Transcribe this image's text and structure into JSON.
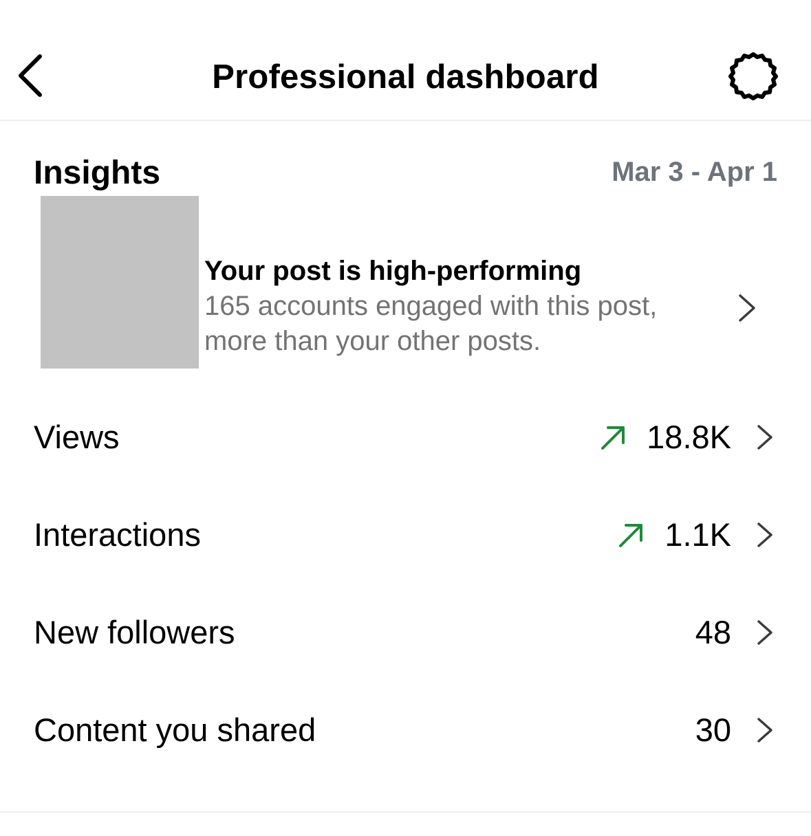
{
  "header": {
    "title": "Professional dashboard",
    "back_icon": "chevron-left-icon",
    "settings_icon": "gear-icon"
  },
  "insights": {
    "title": "Insights",
    "date_range": "Mar 3 - Apr 1"
  },
  "highlight": {
    "title": "Your post is high-performing",
    "body": "165 accounts engaged with this post, more than your other posts."
  },
  "metrics": [
    {
      "label": "Views",
      "value": "18.8K",
      "trend": "up"
    },
    {
      "label": "Interactions",
      "value": "1.1K",
      "trend": "up"
    },
    {
      "label": "New followers",
      "value": "48",
      "trend": "none"
    },
    {
      "label": "Content you shared",
      "value": "30",
      "trend": "none"
    }
  ],
  "colors": {
    "trend_up": "#1f8a3b",
    "secondary_text": "#737373",
    "date_text": "#6e737b",
    "thumbnail_placeholder": "#c2c2c2"
  }
}
